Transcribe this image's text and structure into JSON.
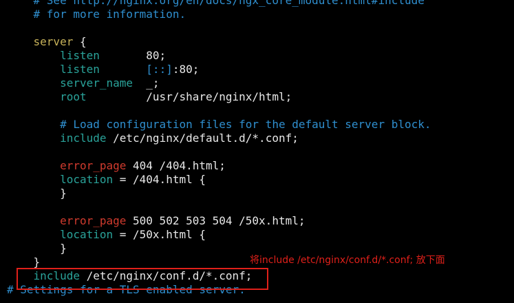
{
  "colors": {
    "background": "#000000",
    "comment": "#2f8fcf",
    "keyword": "#c8b35a",
    "directive": "#2aa39a",
    "danger": "#d13b2e",
    "text": "#e8e8e8",
    "highlight": "#e0201a"
  },
  "lines": [
    [
      {
        "t": "    ",
        "c": "plain"
      },
      {
        "t": "# See http://nginx.org/en/docs/ngx_core_module.html#include",
        "c": "comment"
      }
    ],
    [
      {
        "t": "    ",
        "c": "plain"
      },
      {
        "t": "# for more information.",
        "c": "comment"
      }
    ],
    [
      {
        "t": "",
        "c": "plain"
      }
    ],
    [
      {
        "t": "    ",
        "c": "plain"
      },
      {
        "t": "server",
        "c": "keyword"
      },
      {
        "t": " {",
        "c": "plain"
      }
    ],
    [
      {
        "t": "        ",
        "c": "plain"
      },
      {
        "t": "listen",
        "c": "directive"
      },
      {
        "t": "       80;",
        "c": "plain"
      }
    ],
    [
      {
        "t": "        ",
        "c": "plain"
      },
      {
        "t": "listen",
        "c": "directive"
      },
      {
        "t": "       ",
        "c": "plain"
      },
      {
        "t": "[::]",
        "c": "ipv6"
      },
      {
        "t": ":80;",
        "c": "plain"
      }
    ],
    [
      {
        "t": "        ",
        "c": "plain"
      },
      {
        "t": "server_name",
        "c": "directive"
      },
      {
        "t": "  _;",
        "c": "plain"
      }
    ],
    [
      {
        "t": "        ",
        "c": "plain"
      },
      {
        "t": "root",
        "c": "directive"
      },
      {
        "t": "         /usr/share/nginx/html;",
        "c": "plain"
      }
    ],
    [
      {
        "t": "",
        "c": "plain"
      }
    ],
    [
      {
        "t": "        ",
        "c": "plain"
      },
      {
        "t": "# Load configuration files for the default server block.",
        "c": "comment"
      }
    ],
    [
      {
        "t": "        ",
        "c": "plain"
      },
      {
        "t": "include",
        "c": "directive"
      },
      {
        "t": " /etc/nginx/default.d/*.conf;",
        "c": "plain"
      }
    ],
    [
      {
        "t": "",
        "c": "plain"
      }
    ],
    [
      {
        "t": "        ",
        "c": "plain"
      },
      {
        "t": "error_page",
        "c": "danger"
      },
      {
        "t": " 404 /404.html;",
        "c": "plain"
      }
    ],
    [
      {
        "t": "        ",
        "c": "plain"
      },
      {
        "t": "location",
        "c": "directive"
      },
      {
        "t": " = /404.html {",
        "c": "plain"
      }
    ],
    [
      {
        "t": "        }",
        "c": "plain"
      }
    ],
    [
      {
        "t": "",
        "c": "plain"
      }
    ],
    [
      {
        "t": "        ",
        "c": "plain"
      },
      {
        "t": "error_page",
        "c": "danger"
      },
      {
        "t": " 500 502 503 504 /50x.html;",
        "c": "plain"
      }
    ],
    [
      {
        "t": "        ",
        "c": "plain"
      },
      {
        "t": "location",
        "c": "directive"
      },
      {
        "t": " = /50x.html {",
        "c": "plain"
      }
    ],
    [
      {
        "t": "        }",
        "c": "plain"
      }
    ],
    [
      {
        "t": "    }",
        "c": "plain"
      }
    ],
    [
      {
        "t": "    ",
        "c": "plain"
      },
      {
        "t": "include",
        "c": "directive"
      },
      {
        "t": " /etc/nginx/conf.d/*.conf;",
        "c": "plain"
      }
    ],
    [
      {
        "t": "# Settings for a TLS enabled server.",
        "c": "comment"
      }
    ]
  ],
  "annotation": {
    "text": "将include /etc/nginx/conf.d/*.conf; 放下面"
  }
}
